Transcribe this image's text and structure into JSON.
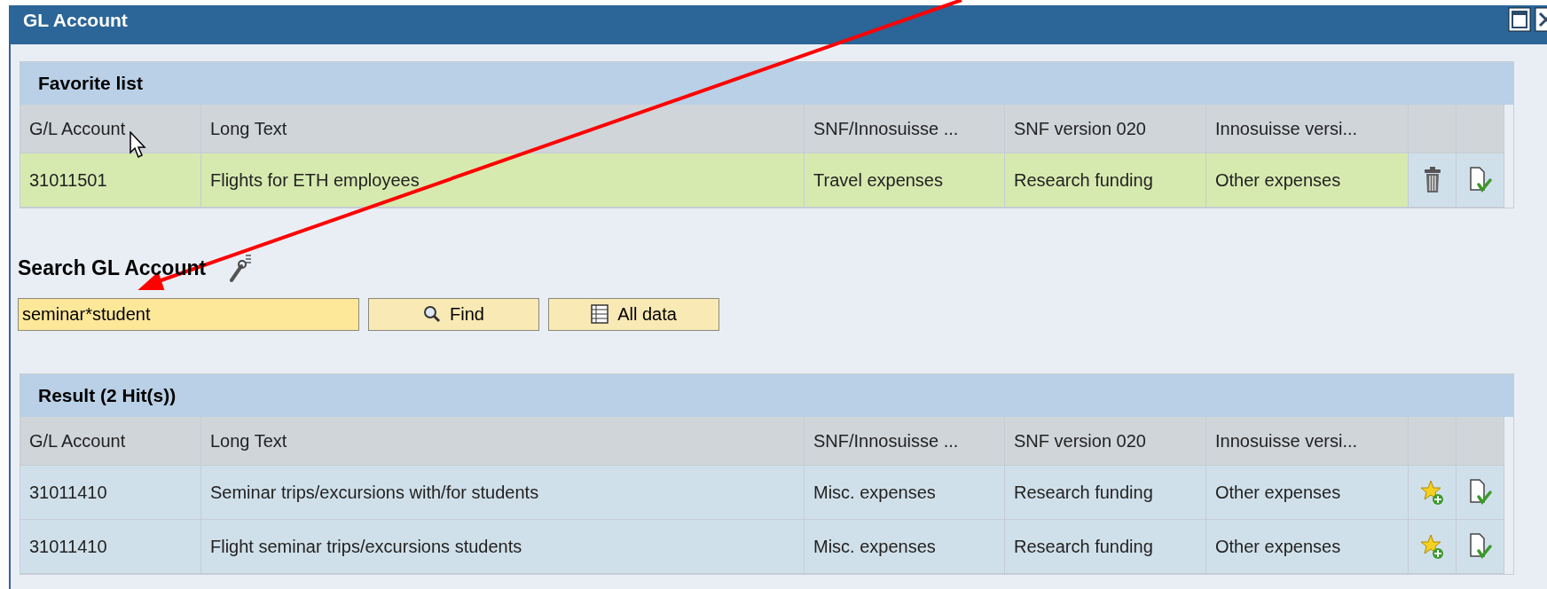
{
  "window": {
    "title": "GL Account"
  },
  "favorites": {
    "title": "Favorite list",
    "columns": [
      "G/L Account",
      "Long Text",
      "SNF/Innosuisse ...",
      "SNF version 020",
      "Innosuisse versi..."
    ],
    "rows": [
      {
        "selected": true,
        "cells": [
          "31011501",
          "Flights for ETH employees",
          "Travel expenses",
          "Research funding",
          "Other expenses"
        ],
        "actions": [
          {
            "kind": "delete"
          },
          {
            "kind": "apply"
          }
        ]
      }
    ]
  },
  "search": {
    "title": "Search GL Account",
    "value": "seminar*student",
    "buttons": [
      {
        "kind": "find",
        "label": "Find"
      },
      {
        "kind": "all",
        "label": "All data"
      }
    ]
  },
  "results": {
    "title": "Result (2 Hit(s))",
    "columns": [
      "G/L Account",
      "Long Text",
      "SNF/Innosuisse ...",
      "SNF version 020",
      "Innosuisse versi..."
    ],
    "rows": [
      {
        "selected": false,
        "cells": [
          "31011410",
          "Seminar trips/excursions with/for students",
          "Misc. expenses",
          "Research funding",
          "Other expenses"
        ],
        "actions": [
          {
            "kind": "favorite"
          },
          {
            "kind": "apply"
          }
        ]
      },
      {
        "selected": false,
        "cells": [
          "31011410",
          "Flight seminar trips/excursions students",
          "Misc. expenses",
          "Research funding",
          "Other expenses"
        ],
        "actions": [
          {
            "kind": "favorite"
          },
          {
            "kind": "apply"
          }
        ]
      }
    ]
  }
}
